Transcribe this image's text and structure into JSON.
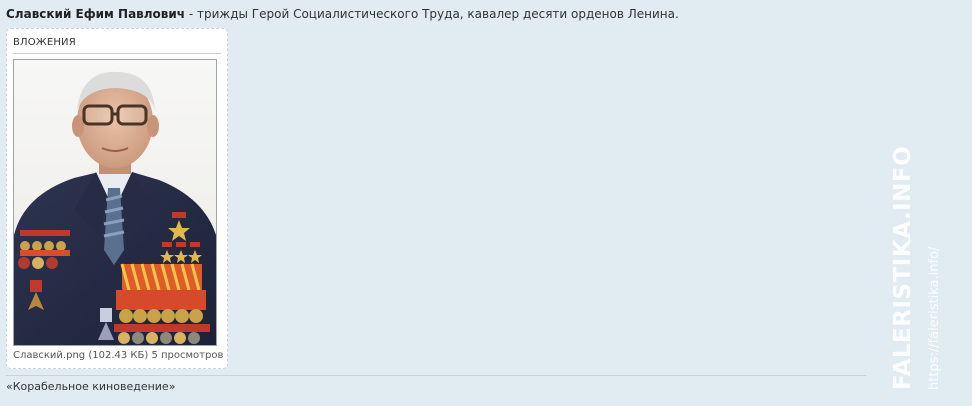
{
  "post": {
    "name": "Славский Ефим Павлович",
    "description": " - трижды Герой Социалистического Труда, кавалер десяти орденов Ленина."
  },
  "attachments": {
    "heading": "ВЛОЖЕНИЯ",
    "file": {
      "name": "Славский.png",
      "size": "(102.43 КБ)",
      "views": "5 просмотров"
    }
  },
  "footer": {
    "link_text": "«Корабельное киноведение»"
  },
  "watermark": {
    "main": "FALERISTIKA.INFO",
    "sub": "https://faleristika.info/"
  }
}
